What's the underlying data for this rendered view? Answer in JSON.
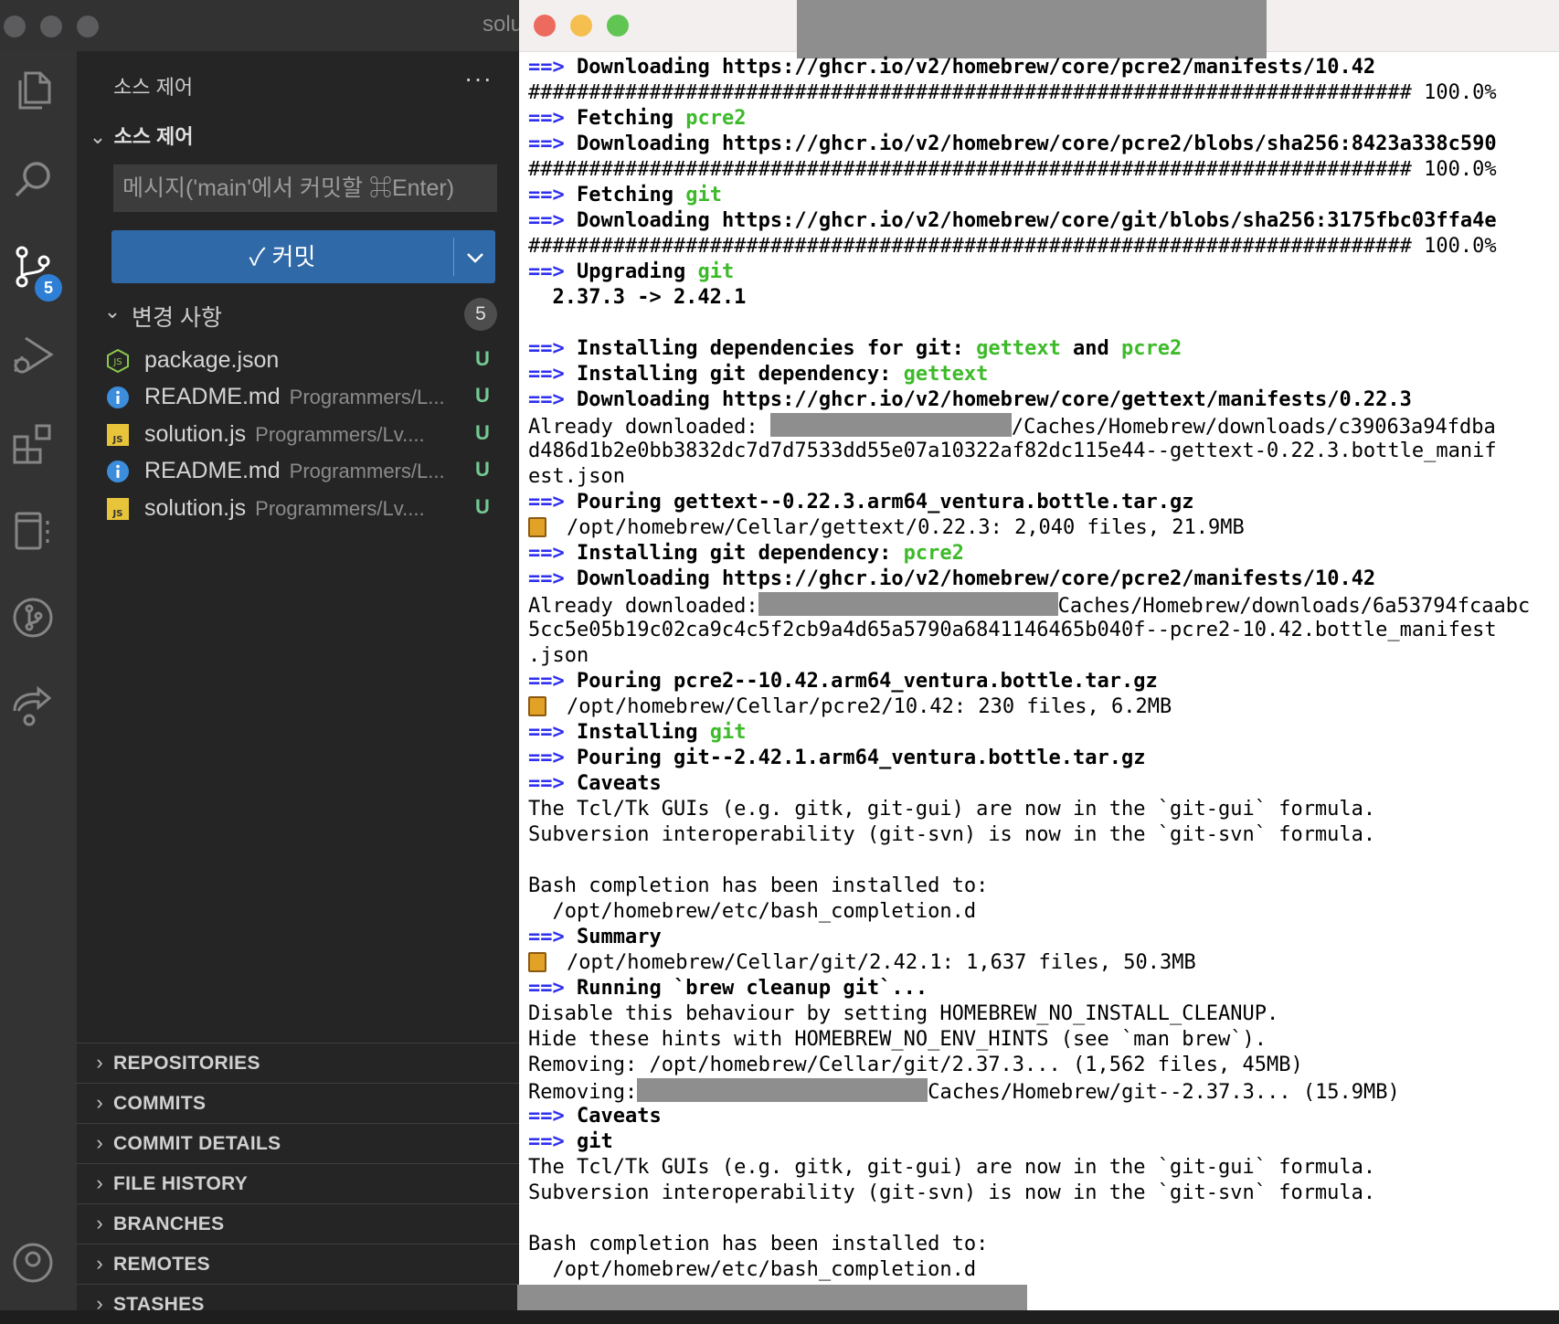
{
  "vscode": {
    "window_title": "solu",
    "activity_badge": "5",
    "sidebar": {
      "header": "소스 제어",
      "more": "···",
      "section_title": "소스 제어",
      "commit_placeholder": "메시지('main'에서 커밋할 ⌘Enter)",
      "commit_label": "✓ 커밋",
      "commit_dropdown": "∨",
      "changes_label": "변경 사항",
      "changes_count": "5",
      "files": [
        {
          "name": "package.json",
          "path": "",
          "status": "U",
          "icon": "nodejs-icon"
        },
        {
          "name": "README.md",
          "path": "Programmers/L...",
          "status": "U",
          "icon": "info-icon"
        },
        {
          "name": "solution.js",
          "path": "Programmers/Lv....",
          "status": "U",
          "icon": "js-icon"
        },
        {
          "name": "README.md",
          "path": "Programmers/L...",
          "status": "U",
          "icon": "info-icon"
        },
        {
          "name": "solution.js",
          "path": "Programmers/Lv....",
          "status": "U",
          "icon": "js-icon"
        }
      ]
    },
    "panels": [
      "REPOSITORIES",
      "COMMITS",
      "COMMIT DETAILS",
      "FILE HISTORY",
      "BRANCHES",
      "REMOTES",
      "STASHES"
    ]
  },
  "terminal": {
    "lines": [
      {
        "arrow": "==>",
        "text": "Downloading https://ghcr.io/v2/homebrew/core/pcre2/manifests/10.42"
      },
      {
        "text": "######################################################################### 100.0%"
      },
      {
        "arrow": "==>",
        "text": "Fetching ",
        "green": "pcre2"
      },
      {
        "arrow": "==>",
        "text": "Downloading https://ghcr.io/v2/homebrew/core/pcre2/blobs/sha256:8423a338c590"
      },
      {
        "text": "######################################################################### 100.0%"
      },
      {
        "arrow": "==>",
        "text": "Fetching ",
        "green": "git"
      },
      {
        "arrow": "==>",
        "text": "Downloading https://ghcr.io/v2/homebrew/core/git/blobs/sha256:3175fbc03ffa4e"
      },
      {
        "text": "######################################################################### 100.0%"
      },
      {
        "arrow": "==>",
        "text": "Upgrading ",
        "green": "git"
      },
      {
        "text": "  2.37.3 -> 2.42.1",
        "bold": true
      },
      {
        "text": ""
      },
      {
        "arrow": "==>",
        "text": "Installing dependencies for git: ",
        "green": "gettext",
        "text2": " and ",
        "green2": "pcre2"
      },
      {
        "arrow": "==>",
        "text": "Installing git dependency: ",
        "green": "gettext"
      },
      {
        "arrow": "==>",
        "text": "Downloading https://ghcr.io/v2/homebrew/core/gettext/manifests/0.22.3"
      },
      {
        "text": "Already downloaded: ",
        "redact": true,
        "text2": "/Caches/Homebrew/downloads/c39063a94fdba"
      },
      {
        "text": "d486d1b2e0bb3832dc7d7d7533dd55e07a10322af82dc115e44--gettext-0.22.3.bottle_manif"
      },
      {
        "text": "est.json"
      },
      {
        "arrow": "==>",
        "text": "Pouring gettext--0.22.3.arm64_ventura.bottle.tar.gz"
      },
      {
        "beer": true,
        "text": "/opt/homebrew/Cellar/gettext/0.22.3: 2,040 files, 21.9MB"
      },
      {
        "arrow": "==>",
        "text": "Installing git dependency: ",
        "green": "pcre2"
      },
      {
        "arrow": "==>",
        "text": "Downloading https://ghcr.io/v2/homebrew/core/pcre2/manifests/10.42"
      },
      {
        "text": "Already downloaded:",
        "redact": true,
        "text2": "Caches/Homebrew/downloads/6a53794fcaabc"
      },
      {
        "text": "5cc5e05b19c02ca9c4c5f2cb9a4d65a5790a6841146465b040f--pcre2-10.42.bottle_manifest"
      },
      {
        "text": ".json"
      },
      {
        "arrow": "==>",
        "text": "Pouring pcre2--10.42.arm64_ventura.bottle.tar.gz"
      },
      {
        "beer": true,
        "text": "/opt/homebrew/Cellar/pcre2/10.42: 230 files, 6.2MB"
      },
      {
        "arrow": "==>",
        "text": "Installing ",
        "green": "git"
      },
      {
        "arrow": "==>",
        "text": "Pouring git--2.42.1.arm64_ventura.bottle.tar.gz"
      },
      {
        "arrow": "==>",
        "text": "Caveats"
      },
      {
        "text": "The Tcl/Tk GUIs (e.g. gitk, git-gui) are now in the `git-gui` formula."
      },
      {
        "text": "Subversion interoperability (git-svn) is now in the `git-svn` formula."
      },
      {
        "text": ""
      },
      {
        "text": "Bash completion has been installed to:"
      },
      {
        "text": "  /opt/homebrew/etc/bash_completion.d"
      },
      {
        "arrow": "==>",
        "text": "Summary"
      },
      {
        "beer": true,
        "text": "/opt/homebrew/Cellar/git/2.42.1: 1,637 files, 50.3MB"
      },
      {
        "arrow": "==>",
        "text": "Running `brew cleanup git`..."
      },
      {
        "text": "Disable this behaviour by setting HOMEBREW_NO_INSTALL_CLEANUP."
      },
      {
        "text": "Hide these hints with HOMEBREW_NO_ENV_HINTS (see `man brew`)."
      },
      {
        "text": "Removing: /opt/homebrew/Cellar/git/2.37.3... (1,562 files, 45MB)"
      },
      {
        "text": "Removing:",
        "redact": true,
        "text2": "Caches/Homebrew/git--2.37.3... (15.9MB)"
      },
      {
        "arrow": "==>",
        "text": "Caveats"
      },
      {
        "arrow": "==>",
        "text": "git"
      },
      {
        "text": "The Tcl/Tk GUIs (e.g. gitk, git-gui) are now in the `git-gui` formula."
      },
      {
        "text": "Subversion interoperability (git-svn) is now in the `git-svn` formula."
      },
      {
        "text": ""
      },
      {
        "text": "Bash completion has been installed to:"
      },
      {
        "text": "  /opt/homebrew/etc/bash_completion.d"
      }
    ]
  },
  "colors": {
    "arrow": "#2f2ff0",
    "green": "#3dba2a",
    "commit_button": "#2f69a8",
    "untracked": "#73c991",
    "badge": "#2f7fd6"
  }
}
